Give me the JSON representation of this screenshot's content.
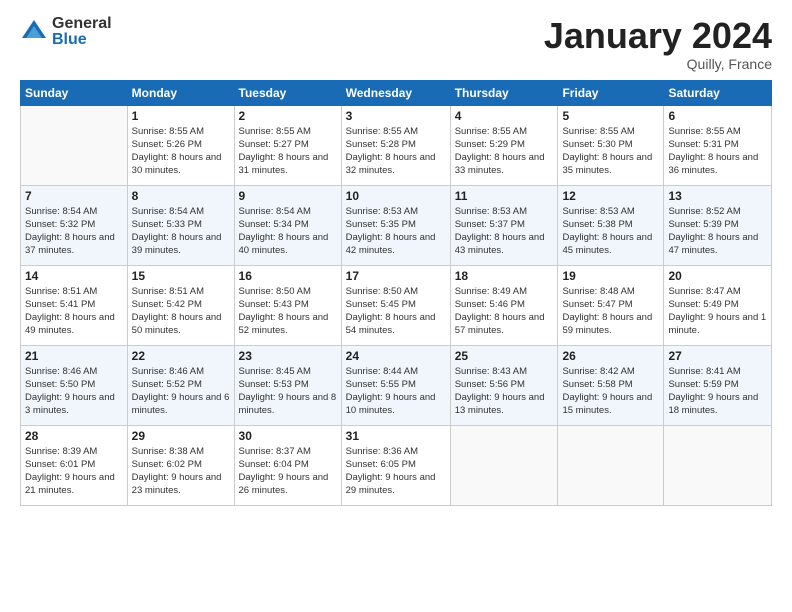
{
  "logo": {
    "general": "General",
    "blue": "Blue"
  },
  "title": {
    "month": "January 2024",
    "location": "Quilly, France"
  },
  "days_of_week": [
    "Sunday",
    "Monday",
    "Tuesday",
    "Wednesday",
    "Thursday",
    "Friday",
    "Saturday"
  ],
  "weeks": [
    [
      {
        "day": "",
        "sunrise": "",
        "sunset": "",
        "daylight": "",
        "empty": true
      },
      {
        "day": "1",
        "sunrise": "Sunrise: 8:55 AM",
        "sunset": "Sunset: 5:26 PM",
        "daylight": "Daylight: 8 hours and 30 minutes."
      },
      {
        "day": "2",
        "sunrise": "Sunrise: 8:55 AM",
        "sunset": "Sunset: 5:27 PM",
        "daylight": "Daylight: 8 hours and 31 minutes."
      },
      {
        "day": "3",
        "sunrise": "Sunrise: 8:55 AM",
        "sunset": "Sunset: 5:28 PM",
        "daylight": "Daylight: 8 hours and 32 minutes."
      },
      {
        "day": "4",
        "sunrise": "Sunrise: 8:55 AM",
        "sunset": "Sunset: 5:29 PM",
        "daylight": "Daylight: 8 hours and 33 minutes."
      },
      {
        "day": "5",
        "sunrise": "Sunrise: 8:55 AM",
        "sunset": "Sunset: 5:30 PM",
        "daylight": "Daylight: 8 hours and 35 minutes."
      },
      {
        "day": "6",
        "sunrise": "Sunrise: 8:55 AM",
        "sunset": "Sunset: 5:31 PM",
        "daylight": "Daylight: 8 hours and 36 minutes."
      }
    ],
    [
      {
        "day": "7",
        "sunrise": "Sunrise: 8:54 AM",
        "sunset": "Sunset: 5:32 PM",
        "daylight": "Daylight: 8 hours and 37 minutes."
      },
      {
        "day": "8",
        "sunrise": "Sunrise: 8:54 AM",
        "sunset": "Sunset: 5:33 PM",
        "daylight": "Daylight: 8 hours and 39 minutes."
      },
      {
        "day": "9",
        "sunrise": "Sunrise: 8:54 AM",
        "sunset": "Sunset: 5:34 PM",
        "daylight": "Daylight: 8 hours and 40 minutes."
      },
      {
        "day": "10",
        "sunrise": "Sunrise: 8:53 AM",
        "sunset": "Sunset: 5:35 PM",
        "daylight": "Daylight: 8 hours and 42 minutes."
      },
      {
        "day": "11",
        "sunrise": "Sunrise: 8:53 AM",
        "sunset": "Sunset: 5:37 PM",
        "daylight": "Daylight: 8 hours and 43 minutes."
      },
      {
        "day": "12",
        "sunrise": "Sunrise: 8:53 AM",
        "sunset": "Sunset: 5:38 PM",
        "daylight": "Daylight: 8 hours and 45 minutes."
      },
      {
        "day": "13",
        "sunrise": "Sunrise: 8:52 AM",
        "sunset": "Sunset: 5:39 PM",
        "daylight": "Daylight: 8 hours and 47 minutes."
      }
    ],
    [
      {
        "day": "14",
        "sunrise": "Sunrise: 8:51 AM",
        "sunset": "Sunset: 5:41 PM",
        "daylight": "Daylight: 8 hours and 49 minutes."
      },
      {
        "day": "15",
        "sunrise": "Sunrise: 8:51 AM",
        "sunset": "Sunset: 5:42 PM",
        "daylight": "Daylight: 8 hours and 50 minutes."
      },
      {
        "day": "16",
        "sunrise": "Sunrise: 8:50 AM",
        "sunset": "Sunset: 5:43 PM",
        "daylight": "Daylight: 8 hours and 52 minutes."
      },
      {
        "day": "17",
        "sunrise": "Sunrise: 8:50 AM",
        "sunset": "Sunset: 5:45 PM",
        "daylight": "Daylight: 8 hours and 54 minutes."
      },
      {
        "day": "18",
        "sunrise": "Sunrise: 8:49 AM",
        "sunset": "Sunset: 5:46 PM",
        "daylight": "Daylight: 8 hours and 57 minutes."
      },
      {
        "day": "19",
        "sunrise": "Sunrise: 8:48 AM",
        "sunset": "Sunset: 5:47 PM",
        "daylight": "Daylight: 8 hours and 59 minutes."
      },
      {
        "day": "20",
        "sunrise": "Sunrise: 8:47 AM",
        "sunset": "Sunset: 5:49 PM",
        "daylight": "Daylight: 9 hours and 1 minute."
      }
    ],
    [
      {
        "day": "21",
        "sunrise": "Sunrise: 8:46 AM",
        "sunset": "Sunset: 5:50 PM",
        "daylight": "Daylight: 9 hours and 3 minutes."
      },
      {
        "day": "22",
        "sunrise": "Sunrise: 8:46 AM",
        "sunset": "Sunset: 5:52 PM",
        "daylight": "Daylight: 9 hours and 6 minutes."
      },
      {
        "day": "23",
        "sunrise": "Sunrise: 8:45 AM",
        "sunset": "Sunset: 5:53 PM",
        "daylight": "Daylight: 9 hours and 8 minutes."
      },
      {
        "day": "24",
        "sunrise": "Sunrise: 8:44 AM",
        "sunset": "Sunset: 5:55 PM",
        "daylight": "Daylight: 9 hours and 10 minutes."
      },
      {
        "day": "25",
        "sunrise": "Sunrise: 8:43 AM",
        "sunset": "Sunset: 5:56 PM",
        "daylight": "Daylight: 9 hours and 13 minutes."
      },
      {
        "day": "26",
        "sunrise": "Sunrise: 8:42 AM",
        "sunset": "Sunset: 5:58 PM",
        "daylight": "Daylight: 9 hours and 15 minutes."
      },
      {
        "day": "27",
        "sunrise": "Sunrise: 8:41 AM",
        "sunset": "Sunset: 5:59 PM",
        "daylight": "Daylight: 9 hours and 18 minutes."
      }
    ],
    [
      {
        "day": "28",
        "sunrise": "Sunrise: 8:39 AM",
        "sunset": "Sunset: 6:01 PM",
        "daylight": "Daylight: 9 hours and 21 minutes."
      },
      {
        "day": "29",
        "sunrise": "Sunrise: 8:38 AM",
        "sunset": "Sunset: 6:02 PM",
        "daylight": "Daylight: 9 hours and 23 minutes."
      },
      {
        "day": "30",
        "sunrise": "Sunrise: 8:37 AM",
        "sunset": "Sunset: 6:04 PM",
        "daylight": "Daylight: 9 hours and 26 minutes."
      },
      {
        "day": "31",
        "sunrise": "Sunrise: 8:36 AM",
        "sunset": "Sunset: 6:05 PM",
        "daylight": "Daylight: 9 hours and 29 minutes."
      },
      {
        "day": "",
        "sunrise": "",
        "sunset": "",
        "daylight": "",
        "empty": true
      },
      {
        "day": "",
        "sunrise": "",
        "sunset": "",
        "daylight": "",
        "empty": true
      },
      {
        "day": "",
        "sunrise": "",
        "sunset": "",
        "daylight": "",
        "empty": true
      }
    ]
  ]
}
